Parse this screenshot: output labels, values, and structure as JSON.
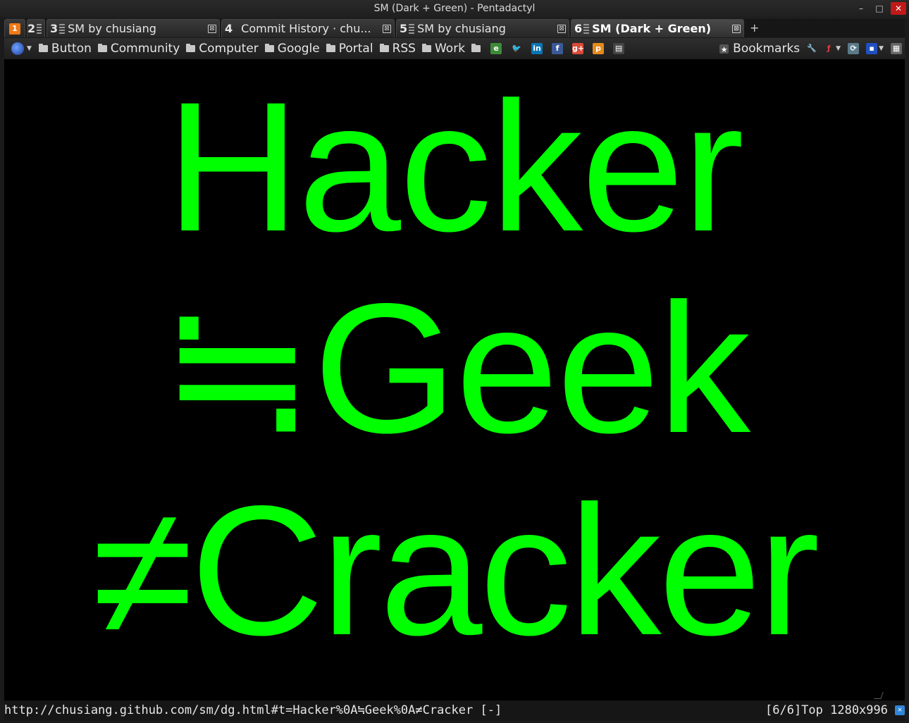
{
  "window": {
    "title": "SM (Dark + Green) - Pentadactyl",
    "controls": {
      "minimize": "–",
      "maximize": "□",
      "close": "✕"
    }
  },
  "tabs": [
    {
      "number": "1",
      "title": "",
      "pinned": true
    },
    {
      "number": "2",
      "title": "",
      "pinned": true
    },
    {
      "number": "3",
      "title": "SM by chusiang",
      "close": "⊠"
    },
    {
      "number": "4",
      "title": "Commit History · chu...",
      "close": "⊠"
    },
    {
      "number": "5",
      "title": "SM by chusiang",
      "close": "⊠"
    },
    {
      "number": "6",
      "title": "SM (Dark + Green)",
      "close": "⊠",
      "active": true
    }
  ],
  "new_tab_label": "+",
  "bookmarks": {
    "folders": [
      "Button",
      "Community",
      "Computer",
      "Google",
      "Portal",
      "RSS",
      "Work"
    ],
    "right_label": "Bookmarks",
    "icons": [
      "evernote-icon",
      "twitter-icon",
      "linkedin-icon",
      "facebook-icon",
      "google-plus-icon",
      "pocket-icon",
      "reader-icon"
    ]
  },
  "page": {
    "line1": "Hacker",
    "line2": "≒Geek",
    "line3": "≠Cracker",
    "text_color": "#00ff00",
    "background_color": "#000000"
  },
  "status": {
    "url": "http://chusiang.github.com/sm/dg.html#t=Hacker%0A≒Geek%0A≠Cracker [-]",
    "position": "[6/6]Top 1280x996"
  }
}
